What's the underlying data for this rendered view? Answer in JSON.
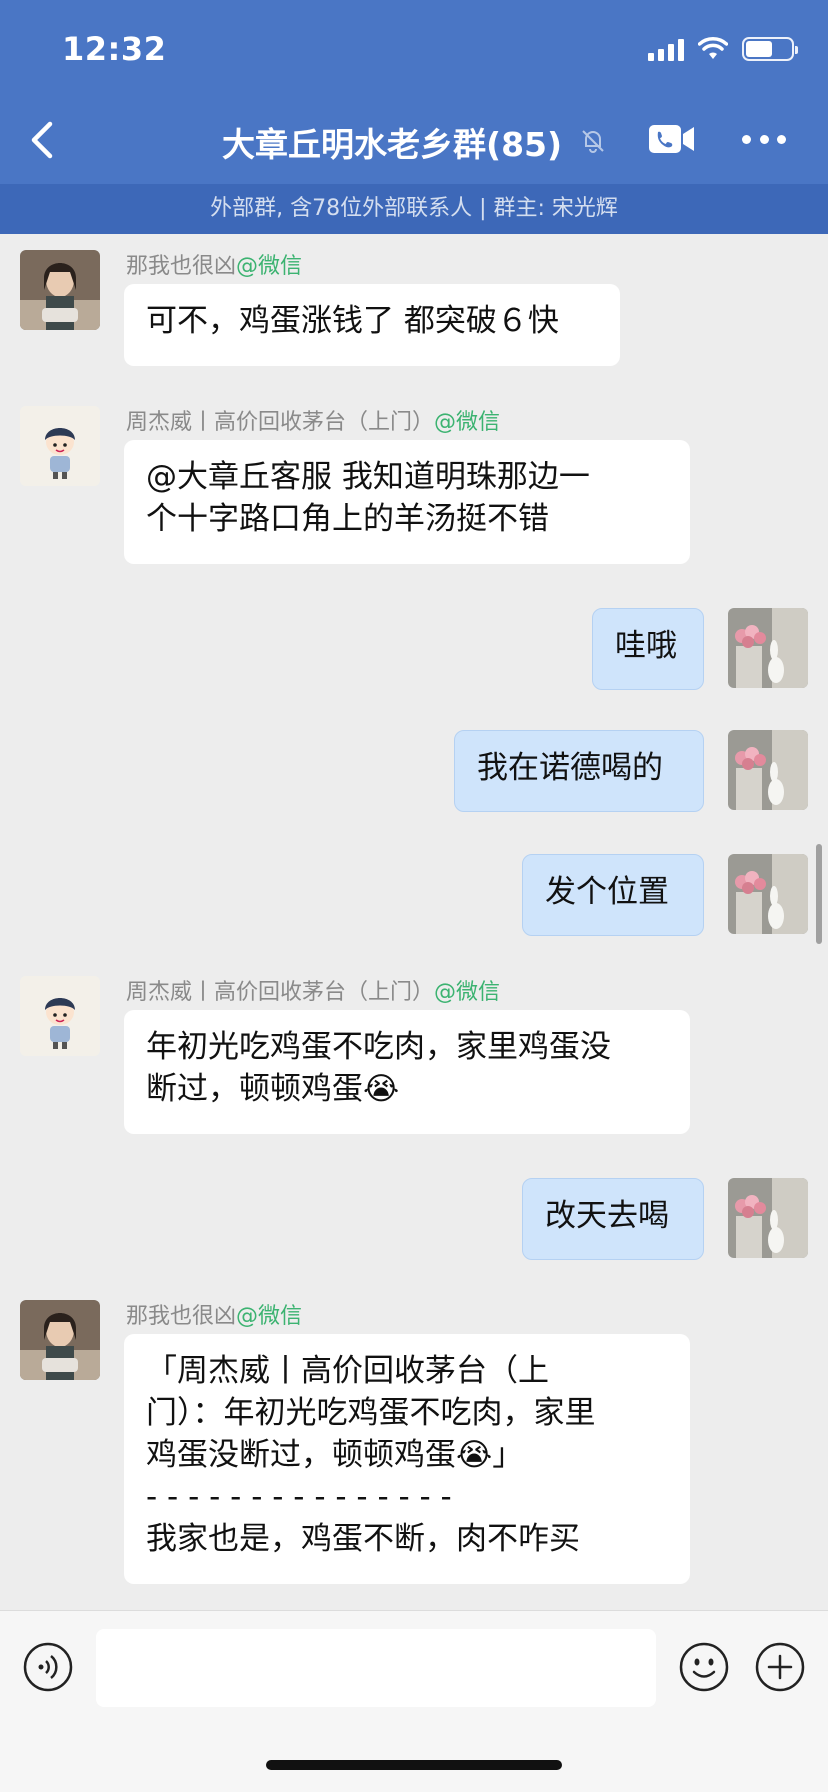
{
  "status": {
    "time": "12:32"
  },
  "header": {
    "title": "大章丘明水老乡群(85)",
    "subtitle": "外部群, 含78位外部联系人 | 群主: 宋光辉"
  },
  "messages": [
    {
      "side": "left",
      "avatar": "avatar-woman",
      "sender": "那我也很凶",
      "tag": "@微信",
      "lines": [
        "可不，鸡蛋涨钱了 都突破６快"
      ]
    },
    {
      "side": "left",
      "avatar": "avatar-cartoon-boy",
      "sender": "周杰威丨高价回收茅台（上门）",
      "tag": "@微信",
      "lines": [
        "@大章丘客服 我知道明珠那边一",
        "个十字路口角上的羊汤挺不错"
      ]
    },
    {
      "side": "right",
      "avatar": "avatar-self-flowers",
      "lines": [
        "哇哦"
      ]
    },
    {
      "side": "right",
      "avatar": "avatar-self-flowers",
      "lines": [
        "我在诺德喝的"
      ]
    },
    {
      "side": "right",
      "avatar": "avatar-self-flowers",
      "lines": [
        "发个位置"
      ]
    },
    {
      "side": "left",
      "avatar": "avatar-cartoon-boy",
      "sender": "周杰威丨高价回收茅台（上门）",
      "tag": "@微信",
      "lines": [
        "年初光吃鸡蛋不吃肉，家里鸡蛋没",
        "断过，顿顿鸡蛋😭"
      ]
    },
    {
      "side": "right",
      "avatar": "avatar-self-flowers",
      "lines": [
        "改天去喝"
      ]
    },
    {
      "side": "left",
      "avatar": "avatar-woman",
      "sender": "那我也很凶",
      "tag": "@微信",
      "lines": [
        "「周杰威丨高价回收茅台（上",
        "门）：年初光吃鸡蛋不吃肉，家里",
        "鸡蛋没断过，顿顿鸡蛋😭」",
        "- - - - - - - - - - - - - - -",
        "我家也是，鸡蛋不断，肉不咋买"
      ]
    }
  ],
  "input": {
    "placeholder": ""
  },
  "icons": {
    "back": "back-chevron-icon",
    "mute": "mute-bell-icon",
    "video": "video-call-icon",
    "more": "more-dots-icon",
    "voice": "voice-icon",
    "emoji": "emoji-icon",
    "plus": "plus-icon"
  },
  "colors": {
    "header": "#4a76c5",
    "subbar": "#3d68b8",
    "my_bubble": "#cfe4fb",
    "wechat_tag": "#3cb371"
  }
}
